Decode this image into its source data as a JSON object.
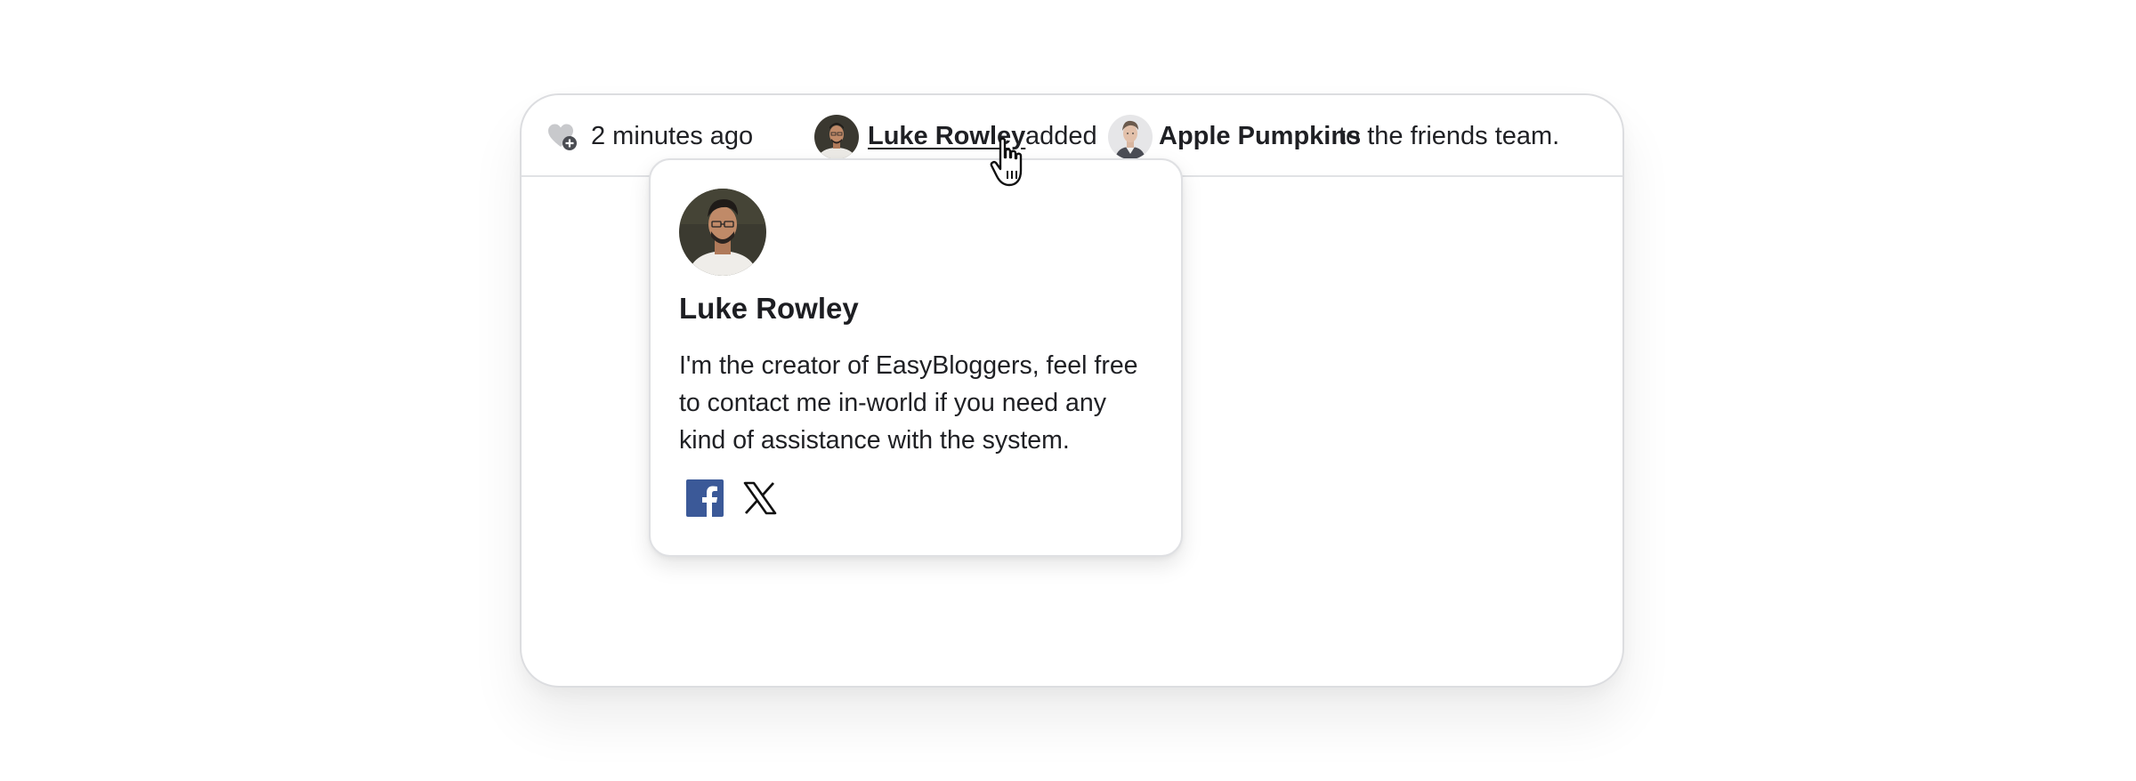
{
  "activity": {
    "time_ago": "2 minutes ago",
    "actor_name": "Luke Rowley",
    "verb": "added",
    "target_name": "Apple Pumpkins",
    "suffix": "to the friends team.",
    "icon": "heart-plus-icon"
  },
  "popover": {
    "name": "Luke Rowley",
    "bio": "I'm the creator of EasyBloggers, feel free to contact me in-world if you need any kind of assistance with the system.",
    "social": [
      {
        "icon": "facebook-icon",
        "color": "#3b5998"
      },
      {
        "icon": "x-icon",
        "color": "#111111"
      }
    ]
  },
  "colors": {
    "border": "#dcdde0",
    "text": "#1f2024",
    "facebook": "#3b5998"
  }
}
